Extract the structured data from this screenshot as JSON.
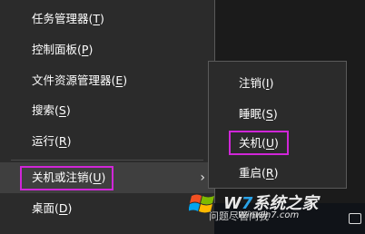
{
  "main_menu": {
    "items": [
      {
        "label": "任务管理器(",
        "key": "T",
        "end": ")"
      },
      {
        "label": "控制面板(",
        "key": "P",
        "end": ")"
      },
      {
        "label": "文件资源管理器(",
        "key": "E",
        "end": ")"
      },
      {
        "label": "搜索(",
        "key": "S",
        "end": ")"
      },
      {
        "label": "运行(",
        "key": "R",
        "end": ")"
      },
      {
        "label": "关机或注销(",
        "key": "U",
        "end": ")"
      },
      {
        "label": "桌面(",
        "key": "D",
        "end": ")"
      }
    ],
    "submenu_arrow": "›"
  },
  "sub_menu": {
    "items": [
      {
        "label": "注销(",
        "key": "I",
        "end": ")"
      },
      {
        "label": "睡眠(",
        "key": "S",
        "end": ")"
      },
      {
        "label": "关机(",
        "key": "U",
        "end": ")"
      },
      {
        "label": "重启(",
        "key": "R",
        "end": ")"
      }
    ]
  },
  "watermark": {
    "brand_prefix": "W",
    "brand_mid": "7",
    "brand_suffix": "系统之家",
    "url": "Winwin7.com",
    "ask_text": "问题尽管问我"
  },
  "colors": {
    "menu_bg": "#2b2b2b",
    "hover_bg": "#3f3f3f",
    "highlight_border": "#d026d8",
    "text": "#ffffff"
  },
  "icons": [
    "windows-logo-icon",
    "chevron-right-icon",
    "tray-icon"
  ]
}
